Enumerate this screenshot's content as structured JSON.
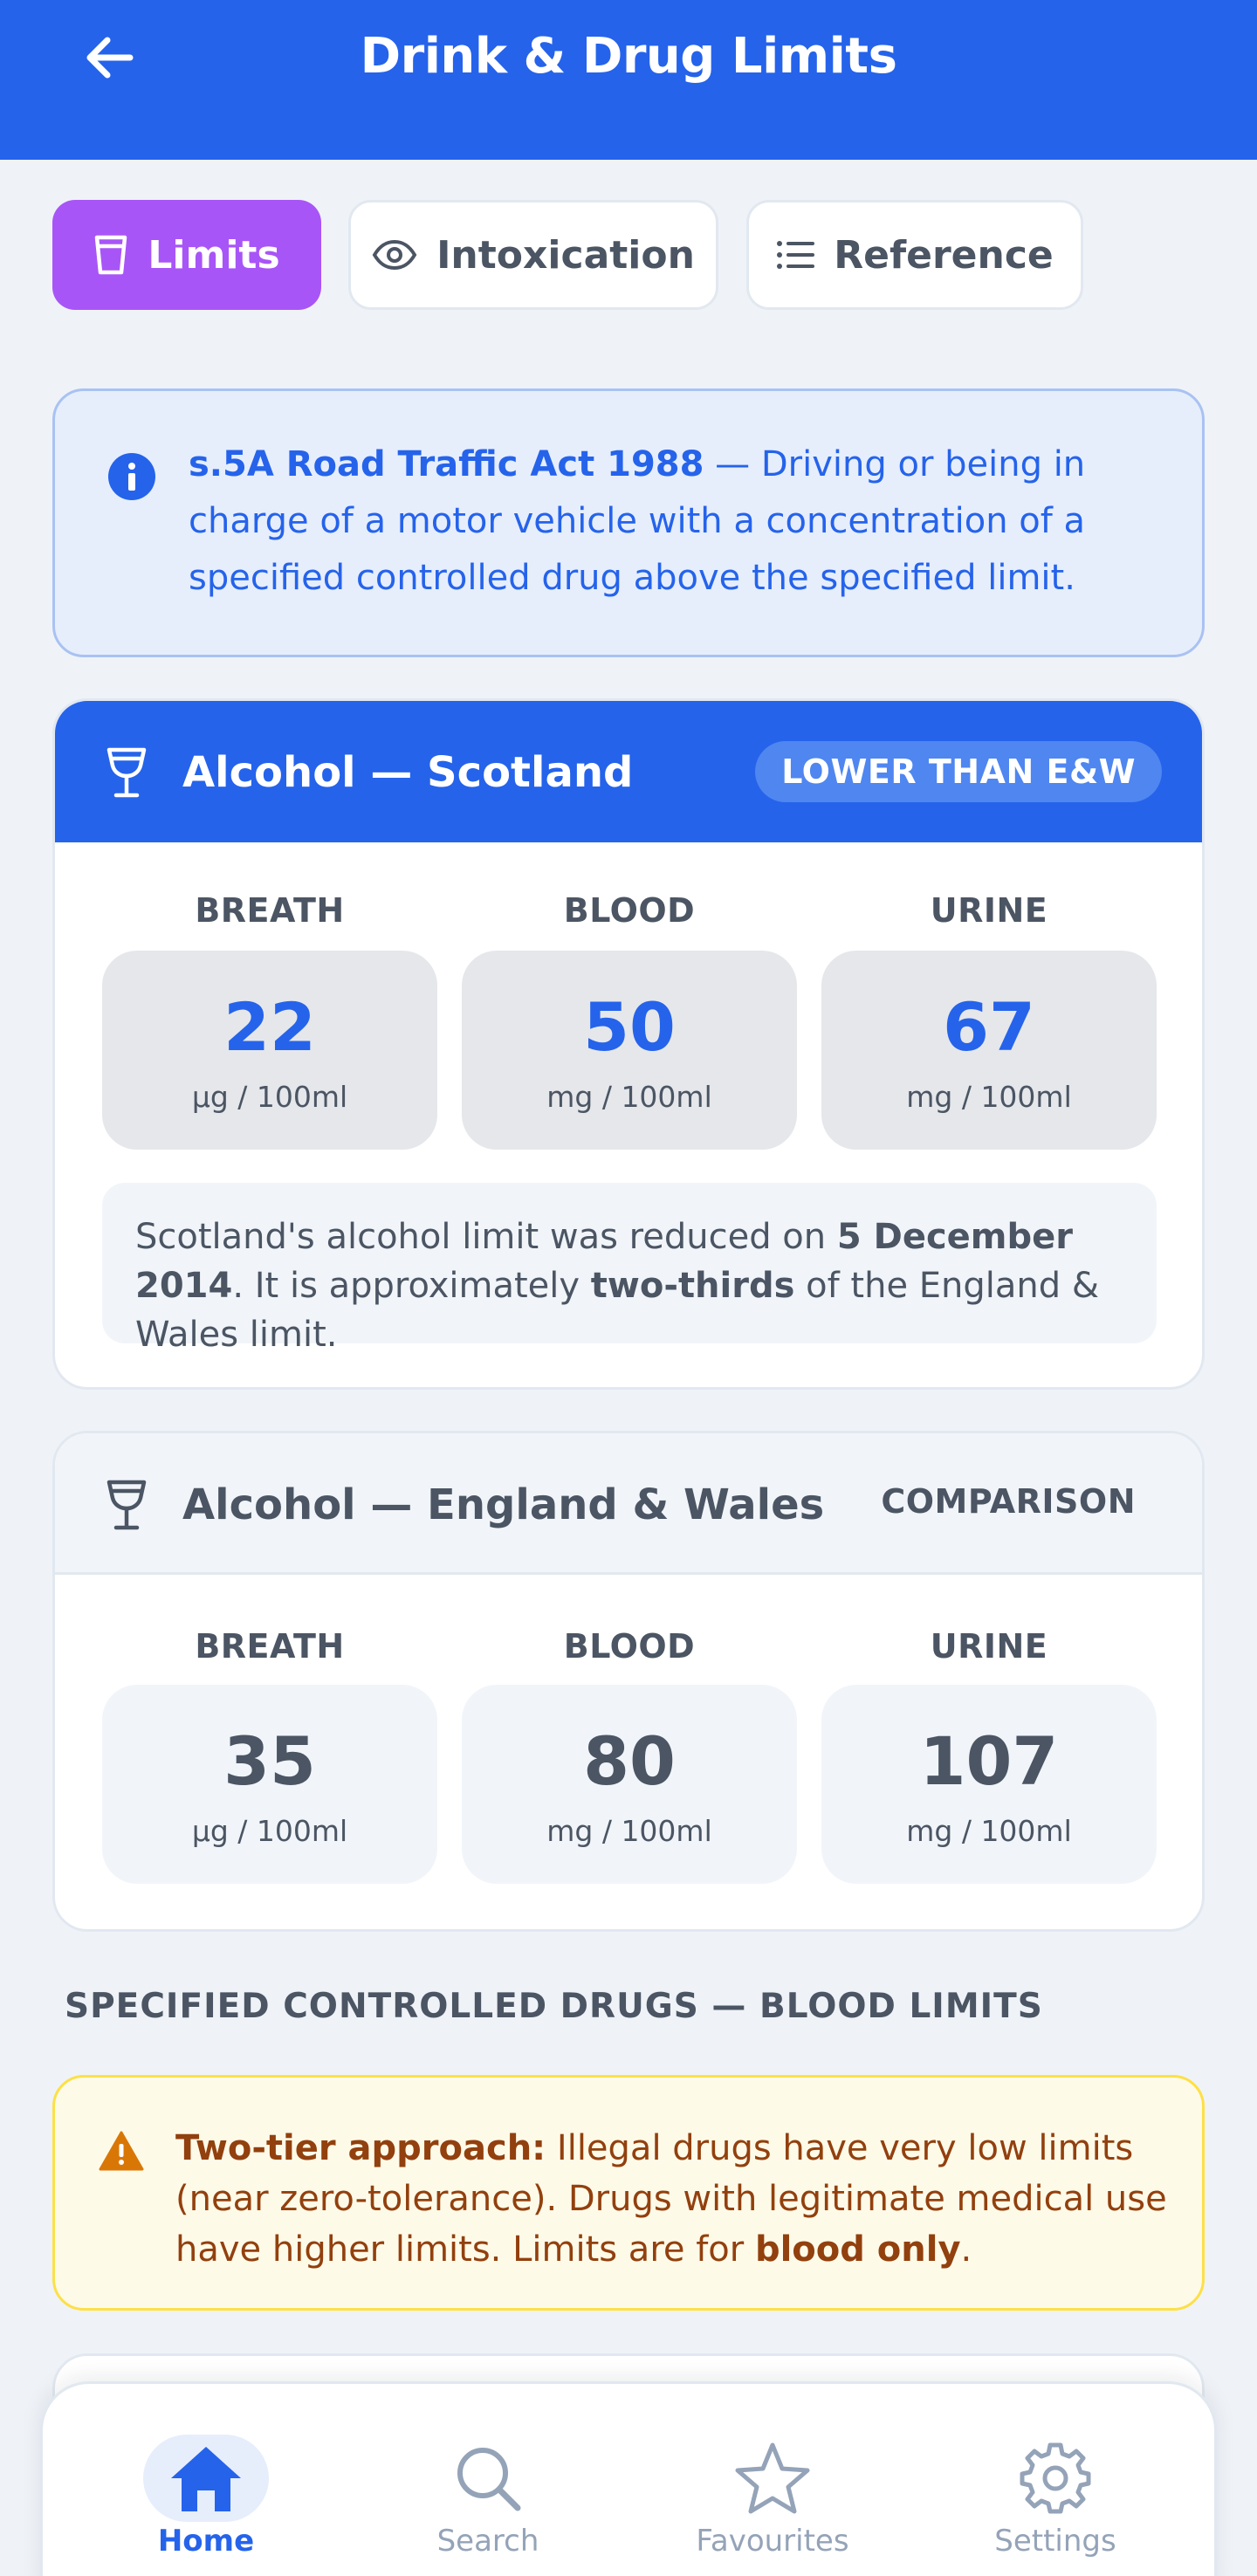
{
  "header": {
    "title": "Drink & Drug Limits",
    "back_icon": "arrow-left-icon"
  },
  "tabs": [
    {
      "label": "Limits",
      "icon": "cup-icon",
      "active": true
    },
    {
      "label": "Intoxication",
      "icon": "eye-icon",
      "active": false
    },
    {
      "label": "Reference",
      "icon": "list-icon",
      "active": false
    }
  ],
  "info_banner": {
    "icon": "info-icon",
    "statute": "s.5A Road Traffic Act 1988",
    "text": " — Driving or being in charge of a motor vehicle with a concentration of a specified controlled drug above the specified limit."
  },
  "scotland_card": {
    "title": "Alcohol — Scotland",
    "badge": "LOWER THAN E&W",
    "icon": "wine-glass-icon",
    "metrics": [
      {
        "label": "BREATH",
        "value": "22",
        "unit": "µg / 100ml"
      },
      {
        "label": "BLOOD",
        "value": "50",
        "unit": "mg / 100ml"
      },
      {
        "label": "URINE",
        "value": "67",
        "unit": "mg / 100ml"
      }
    ],
    "note": {
      "part1": "Scotland's alcohol limit was reduced on ",
      "date": "5 December 2014",
      "part2": ". It is approximately ",
      "fraction": "two-thirds",
      "part3": " of the England & Wales limit."
    }
  },
  "ew_card": {
    "title": "Alcohol — England & Wales",
    "badge": "COMPARISON",
    "icon": "wine-glass-icon",
    "metrics": [
      {
        "label": "BREATH",
        "value": "35",
        "unit": "µg / 100ml"
      },
      {
        "label": "BLOOD",
        "value": "80",
        "unit": "mg / 100ml"
      },
      {
        "label": "URINE",
        "value": "107",
        "unit": "mg / 100ml"
      }
    ]
  },
  "drugs_section": {
    "heading": "SPECIFIED CONTROLLED DRUGS — BLOOD LIMITS"
  },
  "warning_banner": {
    "icon": "warning-icon",
    "lead": "Two-tier approach:",
    "text": " Illegal drugs have very low limits (near zero-tolerance). Drugs with legitimate medical use have higher limits. Limits are for ",
    "emphasis": "blood only",
    "tail": "."
  },
  "bottom_nav": [
    {
      "label": "Home",
      "icon": "home-icon",
      "active": true
    },
    {
      "label": "Search",
      "icon": "search-icon",
      "active": false
    },
    {
      "label": "Favourites",
      "icon": "star-icon",
      "active": false
    },
    {
      "label": "Settings",
      "icon": "gear-icon",
      "active": false
    }
  ],
  "colors": {
    "primary": "#2563eb",
    "accent_tab": "#a855f7",
    "warning_text": "#92400e",
    "warning_bg": "#fefae8",
    "info_bg": "#e6eefc"
  }
}
